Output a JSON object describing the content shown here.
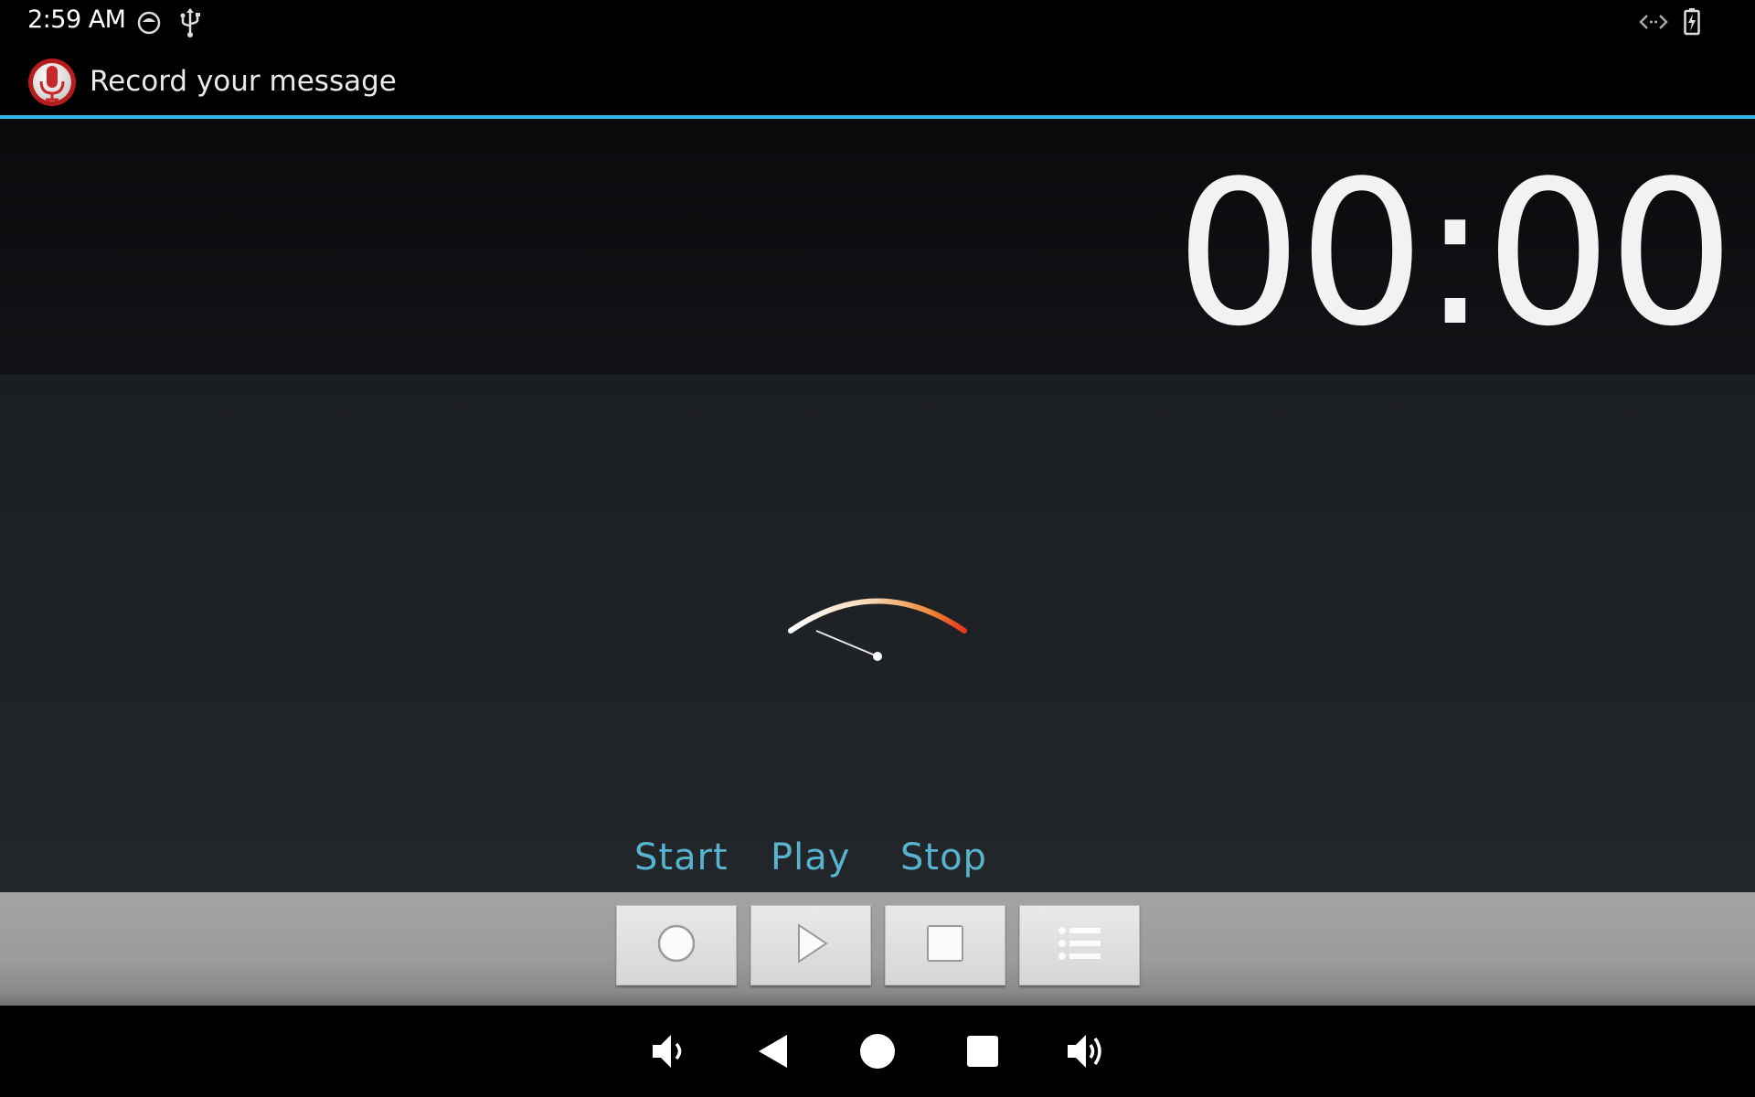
{
  "status": {
    "time": "2:59 AM",
    "icons": [
      "notification-icon",
      "usb-icon",
      "data-transfer-icon",
      "battery-charging-icon"
    ]
  },
  "app": {
    "title": "Record your message",
    "icon": "microphone-icon",
    "accent_color": "#33b5e5"
  },
  "timer": {
    "value": "00:00"
  },
  "labels": {
    "start": "Start",
    "play": "Play",
    "stop": "Stop"
  },
  "controls": [
    {
      "name": "record",
      "icon": "record-icon"
    },
    {
      "name": "play",
      "icon": "play-icon"
    },
    {
      "name": "stop",
      "icon": "stop-icon"
    },
    {
      "name": "list",
      "icon": "list-icon"
    }
  ],
  "navigation": [
    "volume-down-icon",
    "back-icon",
    "home-icon",
    "recents-icon",
    "volume-up-icon"
  ]
}
